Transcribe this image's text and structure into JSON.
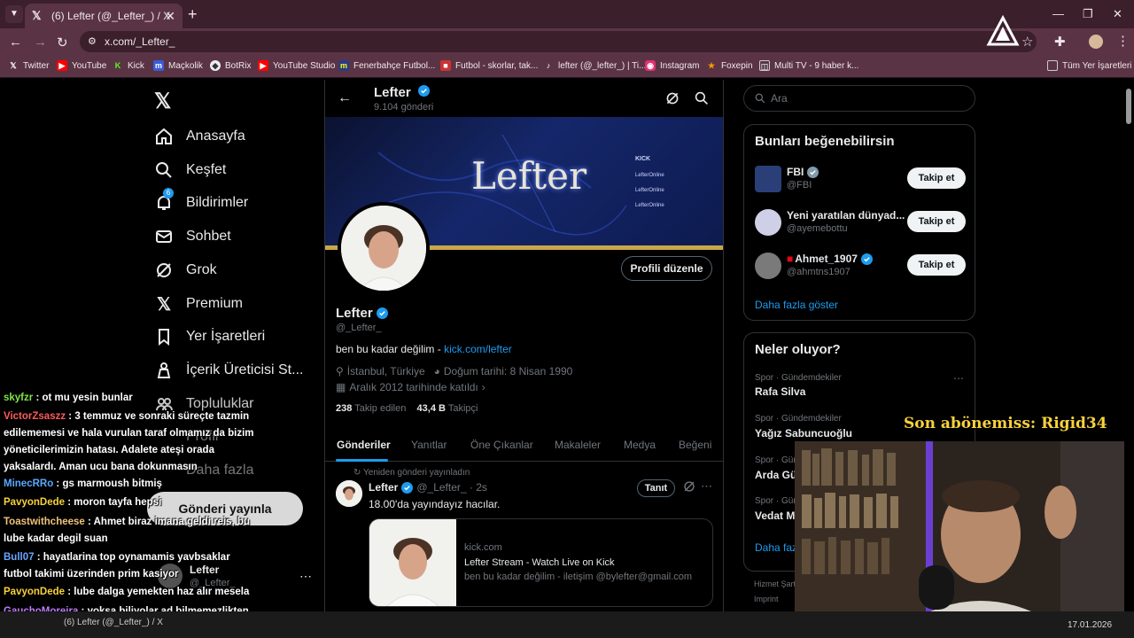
{
  "browser": {
    "tab_title": "(6) Lefter (@_Lefter_) / X",
    "url": "x.com/_Lefter_",
    "bookmarks": [
      "Twitter",
      "YouTube",
      "Kick",
      "Maçkolik",
      "BotRix",
      "YouTube Studio",
      "Fenerbahçe Futbol...",
      "Futbol - skorlar, tak...",
      "lefter (@_lefter_) | Ti...",
      "Instagram",
      "Foxepin",
      "Multi TV - 9 haber k..."
    ],
    "all_bookmarks": "Tüm Yer İşaretleri"
  },
  "nav": {
    "items": [
      "Anasayfa",
      "Keşfet",
      "Bildirimler",
      "Sohbet",
      "Grok",
      "Premium",
      "Yer İşaretleri",
      "İçerik Üreticisi St...",
      "Topluluklar",
      "Profil",
      "Daha fazla"
    ],
    "notif_count": "6",
    "post_button": "Gönderi yayınla",
    "mini_name": "Lefter",
    "mini_handle": "@_Lefter_"
  },
  "profile": {
    "header_name": "Lefter",
    "post_count": "9.104 gönderi",
    "banner_title": "Lefter",
    "banner_side": [
      "KICK",
      "LefterOnline",
      "LefterOnline",
      "LefterOnline"
    ],
    "edit_button": "Profili düzenle",
    "name": "Lefter",
    "handle": "@_Lefter_",
    "bio_text": "ben bu kadar değilim - ",
    "bio_link": "kick.com/lefter",
    "location": "İstanbul, Türkiye",
    "birth": "Doğum tarihi: 8 Nisan 1990",
    "joined": "Aralık 2012 tarihinde katıldı",
    "following_count": "238",
    "following_label": "Takip edilen",
    "followers_count": "43,4 B",
    "followers_label": "Takipçi",
    "tabs": [
      "Gönderiler",
      "Yanıtlar",
      "Öne Çıkanlar",
      "Makaleler",
      "Medya",
      "Beğeni"
    ]
  },
  "tweet": {
    "repost_label": "Yeniden gönderi yayınladın",
    "name": "Lefter",
    "handle_time": "@_Lefter_ · 2s",
    "text": "18.00'da yayındayız hacılar.",
    "promote": "Tanıt",
    "card_domain": "kick.com",
    "card_title": "Lefter Stream - Watch Live on Kick",
    "card_desc": "ben bu kadar değilim - iletişim @bylefter@gmail.com"
  },
  "right": {
    "search_placeholder": "Ara",
    "suggest_title": "Bunları beğenebilirsin",
    "suggestions": [
      {
        "name": "FBI",
        "handle": "@FBI",
        "button": "Takip et"
      },
      {
        "name": "Yeni yaratılan dünyad...",
        "handle": "@ayemebottu",
        "button": "Takip et"
      },
      {
        "name": "Ahmet_1907",
        "handle": "@ahmtns1907",
        "button": "Takip et"
      }
    ],
    "show_more": "Daha fazla göster",
    "trends_title": "Neler oluyor?",
    "trends": [
      {
        "cat": "Spor · Gündemdekiler",
        "name": "Rafa Silva"
      },
      {
        "cat": "Spor · Gündemdekiler",
        "name": "Yağız Sabuncuoğlu"
      },
      {
        "cat": "Spor · Günd",
        "name": "Arda Gü"
      },
      {
        "cat": "Spor · Günd",
        "name": "Vedat M"
      }
    ],
    "trends_more": "Daha faz",
    "footer1": "Hizmet Şart",
    "footer2": "Imprint"
  },
  "overlay": {
    "sub_label": "Son abönemiss: Rigid34",
    "chat": [
      {
        "user": "skyfzr",
        "color": "#7fe34a",
        "msg": " : ot mu yesin bunlar"
      },
      {
        "user": "VictorZsaszz",
        "color": "#ff5a5a",
        "msg": " : 3 temmuz ve sonraki süreçte tazmin edilememesi ve hala vurulan taraf olmamız da bizim yöneticilerimizin hatası. Adalete ateşi orada yaksalardı. Aman ucu bana dokunmasın"
      },
      {
        "user": "MinecRRo",
        "color": "#5aa8ff",
        "msg": " : gs marmoush bitmiş"
      },
      {
        "user": "PavyonDede",
        "color": "#f7d23a",
        "msg": " : moron tayfa hepsi"
      },
      {
        "user": "Toastwithcheese",
        "color": "#f0c27a",
        "msg": " : Ahmet biraz imana geldi reis, bu lube kadar degil suan"
      },
      {
        "user": "Bull07",
        "color": "#6aa6ff",
        "msg": " : hayatlarina top oynamamis yavbsaklar futbol takimi üzerinden prim kasiyor"
      },
      {
        "user": "PavyonDede",
        "color": "#f7d23a",
        "msg": " : lube dalga yemekten haz alır mesela"
      },
      {
        "user": "GauchoMoreira",
        "color": "#c07bff",
        "msg": " : yoksa biliyolar ad bilmemezlikten mi geliyolar"
      }
    ],
    "taskbar_tab": "(6) Lefter (@_Lefter_) / X",
    "clock": "17.01.2026"
  }
}
